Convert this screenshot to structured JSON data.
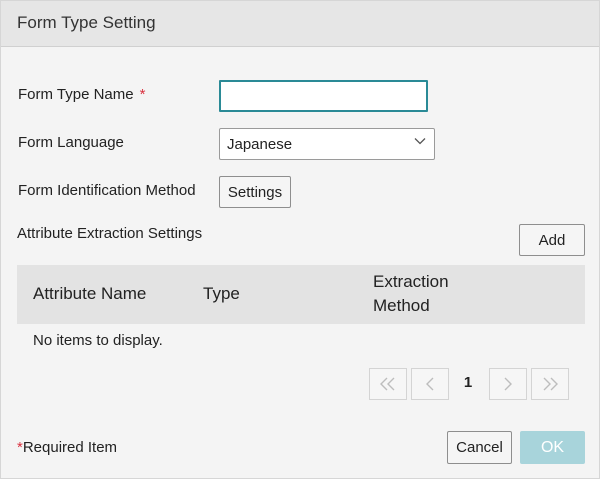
{
  "dialog": {
    "title": "Form Type Setting"
  },
  "form": {
    "type_name_label": "Form Type Name",
    "required_marker": "*",
    "type_name_value": "",
    "language_label": "Form Language",
    "language_value": "Japanese",
    "identification_label": "Form Identification Method",
    "settings_button": "Settings",
    "attribute_section_label": "Attribute Extraction Settings",
    "add_button": "Add"
  },
  "table": {
    "columns": [
      "Attribute Name",
      "Type",
      "Extraction",
      "Method"
    ],
    "empty_message": "No items to display."
  },
  "pagination": {
    "current_page": "1",
    "first_icon": "double-chevron-left",
    "prev_icon": "chevron-left",
    "next_icon": "chevron-right",
    "last_icon": "double-chevron-right"
  },
  "footer": {
    "required_star": "*",
    "required_note": "Required Item",
    "cancel_button": "Cancel",
    "ok_button": "OK"
  },
  "colors": {
    "title_bar": "#e6e6e6",
    "input_focus_border": "#2a8a96",
    "ok_disabled": "#a8d4db",
    "required_star": "#d9303e"
  }
}
